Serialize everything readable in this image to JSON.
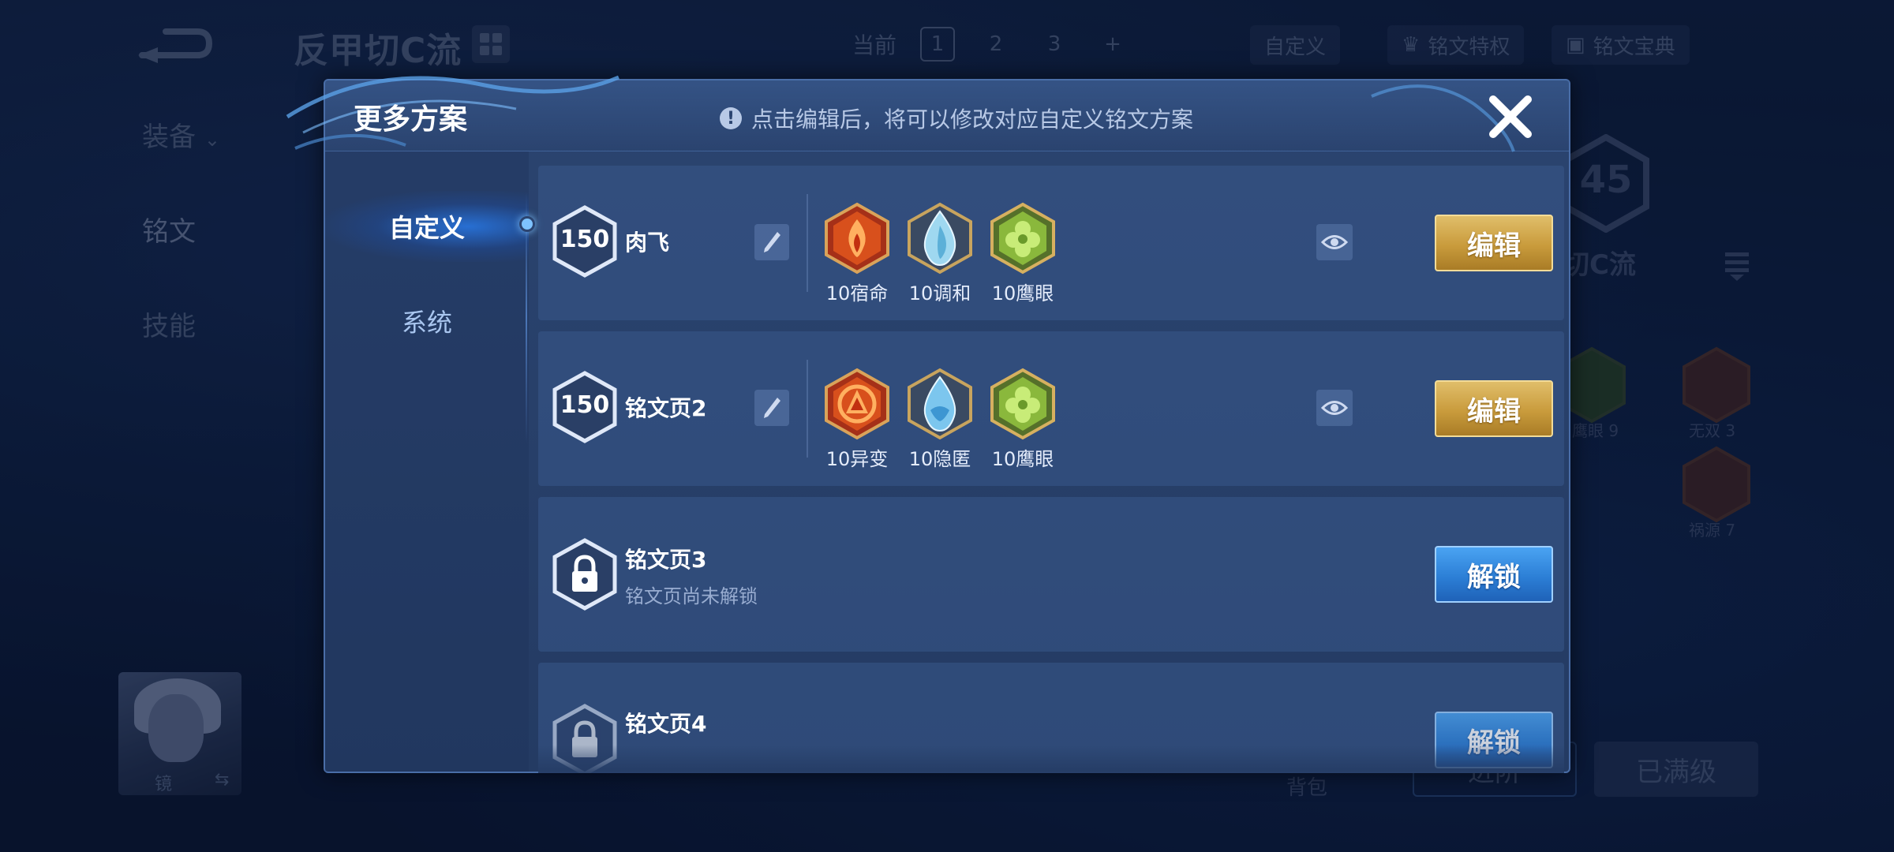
{
  "background": {
    "build_title": "反甲切C流",
    "current_label": "当前",
    "page_tabs": [
      "1",
      "2",
      "3",
      "+"
    ],
    "custom_button": "自定义",
    "privilege_button": "铭文特权",
    "codex_button": "铭文宝典",
    "left_nav": [
      "装备",
      "铭文",
      "技能"
    ],
    "deck_level": "45",
    "deck_name": "切C流",
    "bg_inscriptions": [
      "鹰眼 9",
      "无双 3",
      "祸源 7"
    ],
    "hero_name": "镜",
    "bag_label": "背包",
    "upgrade_button": "进阶",
    "maxed_button": "已满级"
  },
  "modal": {
    "title": "更多方案",
    "notice": "点击编辑后，将可以修改对应自定义铭文方案",
    "side_tabs": [
      {
        "label": "自定义",
        "active": true
      },
      {
        "label": "系统",
        "active": false
      }
    ],
    "pages": [
      {
        "level": "150",
        "name": "肉飞",
        "inscriptions": [
          {
            "label": "10宿命",
            "icon": "red-flame-inscription-icon"
          },
          {
            "label": "10调和",
            "icon": "blue-drop-inscription-icon"
          },
          {
            "label": "10鹰眼",
            "icon": "green-clover-inscription-icon"
          }
        ],
        "action": "编辑"
      },
      {
        "level": "150",
        "name": "铭文页2",
        "inscriptions": [
          {
            "label": "10异变",
            "icon": "red-arrow-inscription-icon"
          },
          {
            "label": "10隐匿",
            "icon": "blue-drop-inscription-icon"
          },
          {
            "label": "10鹰眼",
            "icon": "green-clover-inscription-icon"
          }
        ],
        "action": "编辑"
      },
      {
        "name": "铭文页3",
        "status": "铭文页尚未解锁",
        "action": "解锁"
      },
      {
        "name": "铭文页4",
        "action": "解锁"
      }
    ]
  },
  "colors": {
    "gold_button": "#c99b3c",
    "blue_button": "#2c7fd6",
    "modal_bg": "#2b4470",
    "page_bg": "#0d1d3d"
  }
}
